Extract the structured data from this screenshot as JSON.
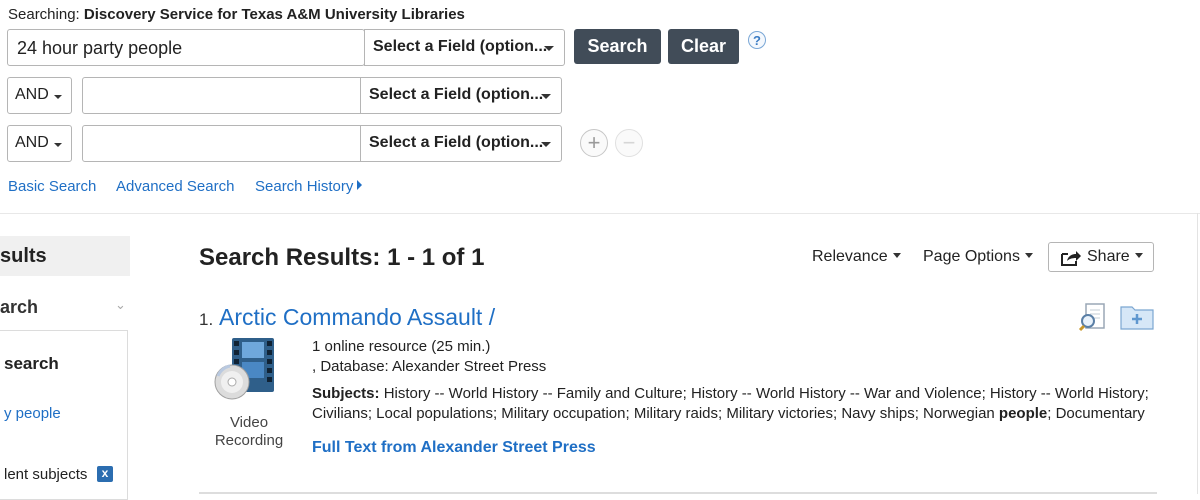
{
  "search": {
    "searching_prefix": "Searching:",
    "service_name": "Discovery Service for Texas A&M University Libraries",
    "query_value": "24 hour party people",
    "field_select_label": "Select a Field (option...",
    "search_button": "Search",
    "clear_button": "Clear",
    "help_icon_glyph": "?",
    "rows": [
      {
        "bool_label": "AND",
        "value": "",
        "field_select_label": "Select a Field (option..."
      },
      {
        "bool_label": "AND",
        "value": "",
        "field_select_label": "Select a Field (option..."
      }
    ],
    "add_row_glyph": "+",
    "remove_row_glyph": "−"
  },
  "nav": {
    "basic_search": "Basic Search",
    "advanced_search": "Advanced Search",
    "search_history": "Search History"
  },
  "sidebar": {
    "title": "sults",
    "subheading": "arch",
    "current_search": "search",
    "query_link": "y people",
    "facet_label": "lent subjects",
    "remove_glyph": "x"
  },
  "results": {
    "heading_label": "Search Results:",
    "heading_count": "1 - 1 of 1",
    "sort_label": "Relevance",
    "page_options_label": "Page Options",
    "share_label": "Share",
    "items": [
      {
        "number": "1.",
        "title": "Arctic Commando Assault /",
        "format_line": "1 online resource (25 min.)",
        "database_line": ", Database: Alexander Street Press",
        "subjects_label": "Subjects:",
        "subjects_before": "History -- World History -- Family and Culture; History -- World History -- War and Violence; History -- World History; Civilians; Local populations; Military occupation; Military raids; Military victories; Navy ships; Norwegian ",
        "subjects_highlight": "people",
        "subjects_after": "; Documentary",
        "type_label_1": "Video",
        "type_label_2": "Recording",
        "full_text_link": "Full Text from Alexander Street Press"
      }
    ]
  },
  "colors": {
    "link_blue": "#1f6fc5",
    "button_dark": "#414c58"
  }
}
